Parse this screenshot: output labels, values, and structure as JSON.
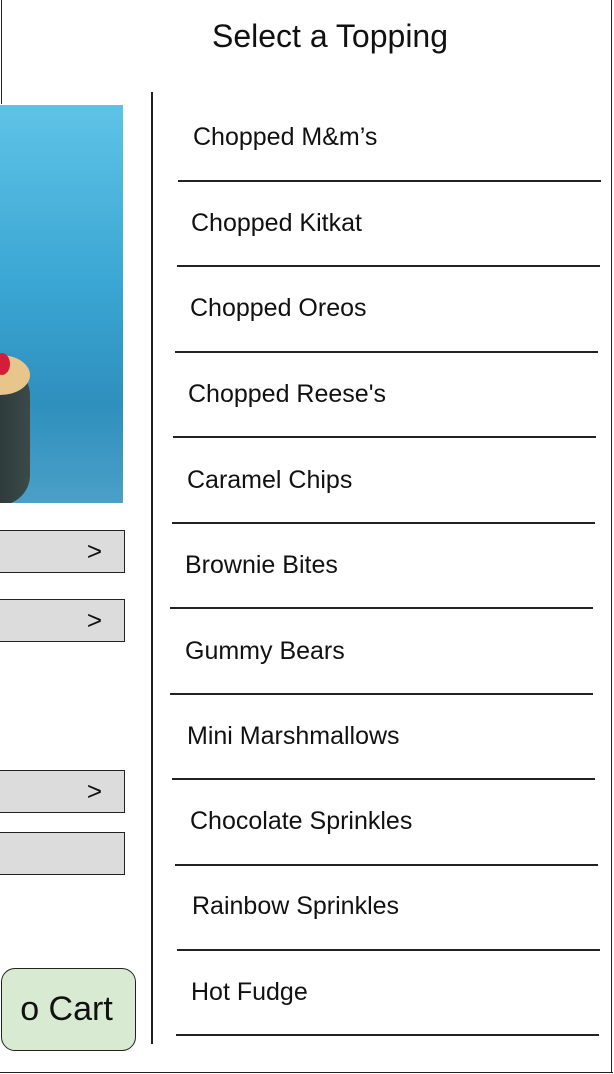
{
  "title": "Select a Topping",
  "toppings": [
    "Chopped M&m’s",
    "Chopped Kitkat",
    "Chopped Oreos",
    "Chopped Reese's",
    "Caramel Chips",
    "Brownie Bites",
    "Gummy Bears",
    "Mini Marshmallows",
    "Chocolate Sprinkles",
    "Rainbow Sprinkles",
    "Hot Fudge"
  ],
  "side_buttons": [
    {
      "chevron": ">"
    },
    {
      "chevron": ">"
    },
    {
      "chevron": ">"
    },
    {
      "chevron": ""
    }
  ],
  "cart_button": {
    "label": "o Cart"
  },
  "colors": {
    "button_gray": "#dcdcdc",
    "cart_green": "#d9ead3",
    "photo_blue": "#3aa6d3"
  }
}
